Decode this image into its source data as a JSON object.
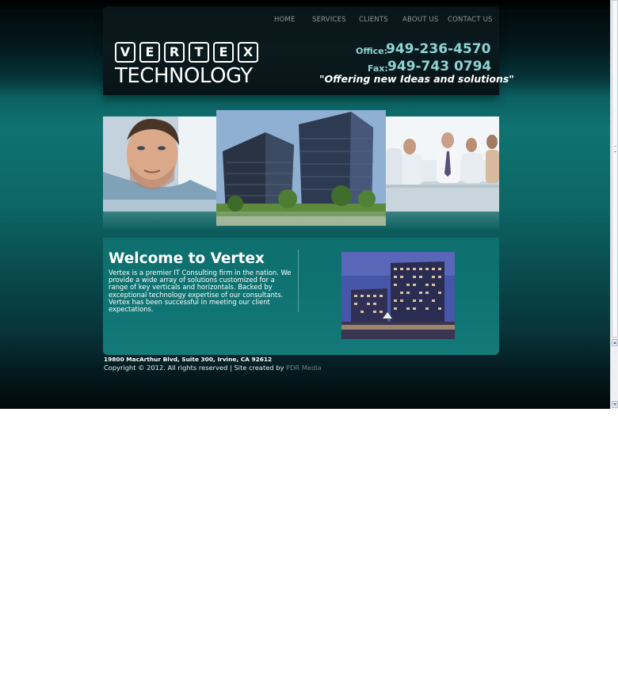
{
  "nav": {
    "home": "HOME",
    "services": "SERVICES",
    "clients": "CLIENTS",
    "about": "ABOUT US",
    "contact": "CONTACT US"
  },
  "logo": {
    "letters": [
      "V",
      "E",
      "R",
      "T",
      "E",
      "X"
    ],
    "subtitle": "TECHNOLOGY"
  },
  "contact": {
    "office_label": "Office:",
    "office_number": "949-236-4570",
    "fax_label": "Fax:",
    "fax_number": "949-743 0794",
    "tagline": "\"Offering new Ideas and solutions\""
  },
  "welcome": {
    "title": "Welcome to Vertex",
    "body": "Vertex is a premier IT Consulting firm in the nation. We provide a wide array of solutions customized for a range of key verticals and horizontals. Backed by exceptional technology expertise of our consultants. Vertex has been successful in meeting our client expectations."
  },
  "footer": {
    "address": "19800 MacArthur Blvd, Suite 300, Irvine, CA 92612",
    "copyright": "Copyright © 2012. All rights reserved | Site created by ",
    "credit_link": "PDR Media"
  },
  "colors": {
    "accent_teal": "#8fd3d3",
    "background_teal": "#0f7371",
    "header_dark": "#091519"
  }
}
